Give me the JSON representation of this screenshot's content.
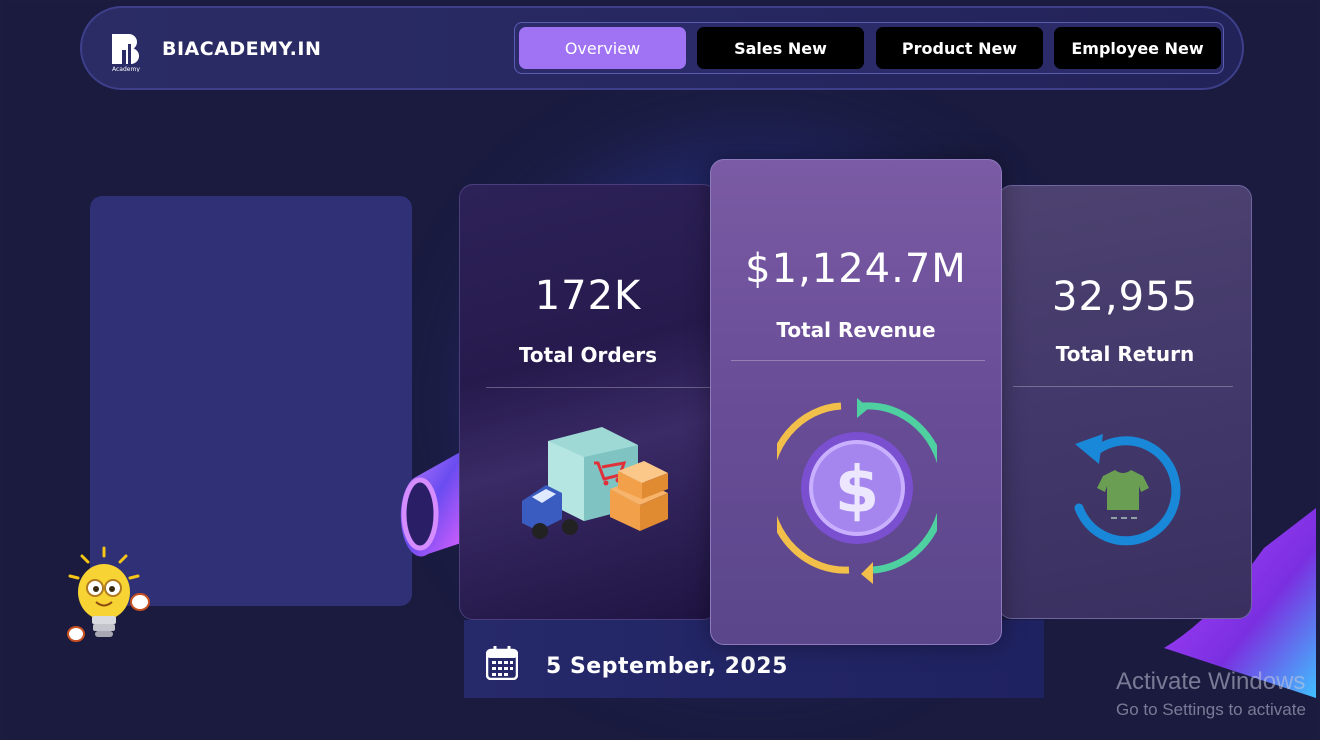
{
  "header": {
    "logo_icon": "biacademy-logo-icon",
    "brand": "BIACADEMY.IN",
    "tabs": [
      {
        "label": "Overview",
        "active": true
      },
      {
        "label": "Sales New",
        "active": false
      },
      {
        "label": "Product New",
        "active": false
      },
      {
        "label": "Employee New",
        "active": false
      }
    ]
  },
  "kpis": {
    "orders": {
      "value": "172K",
      "label": "Total Orders",
      "icon": "delivery-truck-icon"
    },
    "revenue": {
      "value": "$1,124.7M",
      "label": "Total Revenue",
      "icon": "dollar-coin-icon"
    },
    "returns": {
      "value": "32,955",
      "label": "Total Return",
      "icon": "return-tshirt-icon"
    }
  },
  "date": {
    "icon": "calendar-icon",
    "text": "5 September, 2025"
  },
  "decorations": {
    "mascot_icon": "lightbulb-mascot-icon"
  },
  "watermark": {
    "line1": "Activate Windows",
    "line2": "Go to Settings to activate"
  },
  "colors": {
    "accent": "#a072f4",
    "background": "#1a1b3f",
    "panel": "#2f3075"
  }
}
